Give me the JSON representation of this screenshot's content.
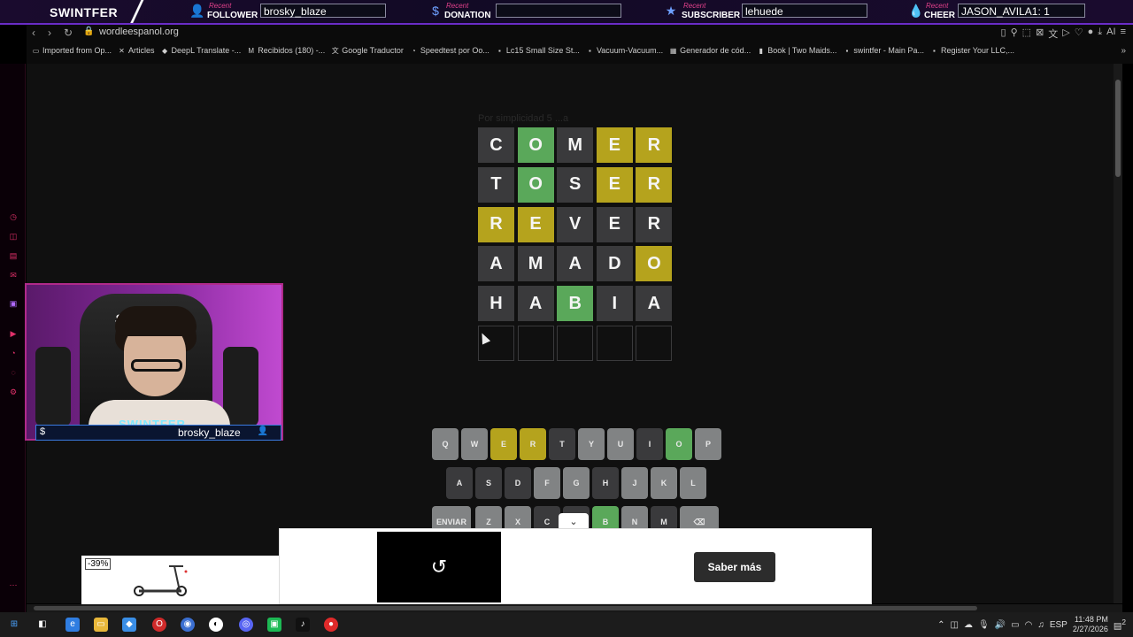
{
  "overlay": {
    "brand": "SWINTFER",
    "recent_label": "Recent",
    "follower_label": "FOLLOWER",
    "follower_value": "brosky_blaze",
    "donation_label": "DONATION",
    "donation_value": "",
    "subscriber_label": "SUBSCRIBER",
    "subscriber_value": "lehuede",
    "cheer_label": "CHEER",
    "cheer_value": "JASON_AVILA1: 1"
  },
  "browser": {
    "url": "wordleespanol.org",
    "bookmarks": [
      {
        "label": "Imported from Op...",
        "icon": "folder-icon"
      },
      {
        "label": "Articles",
        "icon": "articles-icon"
      },
      {
        "label": "DeepL Translate -...",
        "icon": "deepl-icon"
      },
      {
        "label": "Recibidos (180) -...",
        "icon": "gmail-icon"
      },
      {
        "label": "Google Traductor",
        "icon": "translate-icon"
      },
      {
        "label": "Speedtest por Oo...",
        "icon": "speedtest-icon"
      },
      {
        "label": "Lc15 Small Size St...",
        "icon": "page-icon"
      },
      {
        "label": "Vacuum-Vacuum...",
        "icon": "page-icon"
      },
      {
        "label": "Generador de cód...",
        "icon": "grid-icon"
      },
      {
        "label": "Book | Two Maids...",
        "icon": "book-icon"
      },
      {
        "label": "swintfer - Main Pa...",
        "icon": "page-icon"
      },
      {
        "label": "Register Your LLC,...",
        "icon": "page-icon"
      }
    ],
    "toolbar_ai": "AI"
  },
  "game": {
    "subtitle": "Por simplicidad 5 ...a",
    "rows": [
      [
        {
          "l": "C",
          "s": "gray"
        },
        {
          "l": "O",
          "s": "green"
        },
        {
          "l": "M",
          "s": "gray"
        },
        {
          "l": "E",
          "s": "yellow"
        },
        {
          "l": "R",
          "s": "yellow"
        }
      ],
      [
        {
          "l": "T",
          "s": "gray"
        },
        {
          "l": "O",
          "s": "green"
        },
        {
          "l": "S",
          "s": "gray"
        },
        {
          "l": "E",
          "s": "yellow"
        },
        {
          "l": "R",
          "s": "yellow"
        }
      ],
      [
        {
          "l": "R",
          "s": "yellow"
        },
        {
          "l": "E",
          "s": "yellow"
        },
        {
          "l": "V",
          "s": "gray"
        },
        {
          "l": "E",
          "s": "gray"
        },
        {
          "l": "R",
          "s": "gray"
        }
      ],
      [
        {
          "l": "A",
          "s": "gray"
        },
        {
          "l": "M",
          "s": "gray"
        },
        {
          "l": "A",
          "s": "gray"
        },
        {
          "l": "D",
          "s": "gray"
        },
        {
          "l": "O",
          "s": "yellow"
        }
      ],
      [
        {
          "l": "H",
          "s": "gray"
        },
        {
          "l": "A",
          "s": "gray"
        },
        {
          "l": "B",
          "s": "green"
        },
        {
          "l": "I",
          "s": "gray"
        },
        {
          "l": "A",
          "s": "gray"
        }
      ],
      [
        {
          "l": "",
          "s": "empty"
        },
        {
          "l": "",
          "s": "empty"
        },
        {
          "l": "",
          "s": "empty"
        },
        {
          "l": "",
          "s": "empty"
        },
        {
          "l": "",
          "s": "empty"
        }
      ]
    ],
    "keyboard": [
      [
        {
          "k": "Q",
          "s": "light"
        },
        {
          "k": "W",
          "s": "light"
        },
        {
          "k": "E",
          "s": "yellow"
        },
        {
          "k": "R",
          "s": "yellow"
        },
        {
          "k": "T",
          "s": "dark"
        },
        {
          "k": "Y",
          "s": "light"
        },
        {
          "k": "U",
          "s": "light"
        },
        {
          "k": "I",
          "s": "dark"
        },
        {
          "k": "O",
          "s": "green"
        },
        {
          "k": "P",
          "s": "light"
        }
      ],
      [
        {
          "k": "A",
          "s": "dark"
        },
        {
          "k": "S",
          "s": "dark"
        },
        {
          "k": "D",
          "s": "dark"
        },
        {
          "k": "F",
          "s": "light"
        },
        {
          "k": "G",
          "s": "light"
        },
        {
          "k": "H",
          "s": "dark"
        },
        {
          "k": "J",
          "s": "light"
        },
        {
          "k": "K",
          "s": "light"
        },
        {
          "k": "L",
          "s": "light"
        }
      ],
      [
        {
          "k": "ENVIAR",
          "s": "light"
        },
        {
          "k": "Z",
          "s": "light"
        },
        {
          "k": "X",
          "s": "light"
        },
        {
          "k": "C",
          "s": "dark"
        },
        {
          "k": "V",
          "s": "dark"
        },
        {
          "k": "B",
          "s": "green"
        },
        {
          "k": "N",
          "s": "light"
        },
        {
          "k": "M",
          "s": "dark"
        },
        {
          "k": "⌫",
          "s": "light"
        }
      ]
    ]
  },
  "webcam": {
    "chair_logo": "S-R",
    "brand": "SWINTFER",
    "name": "brosky_blaze"
  },
  "ad": {
    "discount": "-39%",
    "cta": "Saber más"
  },
  "taskbar": {
    "time": "11:48 PM",
    "date": "2/27/2026",
    "lang": "ESP",
    "notif_count": "2"
  },
  "colors": {
    "green": "#5aa85a",
    "yellow": "#b5a31d",
    "gray": "#3a3a3c",
    "light_key": "#818384"
  }
}
